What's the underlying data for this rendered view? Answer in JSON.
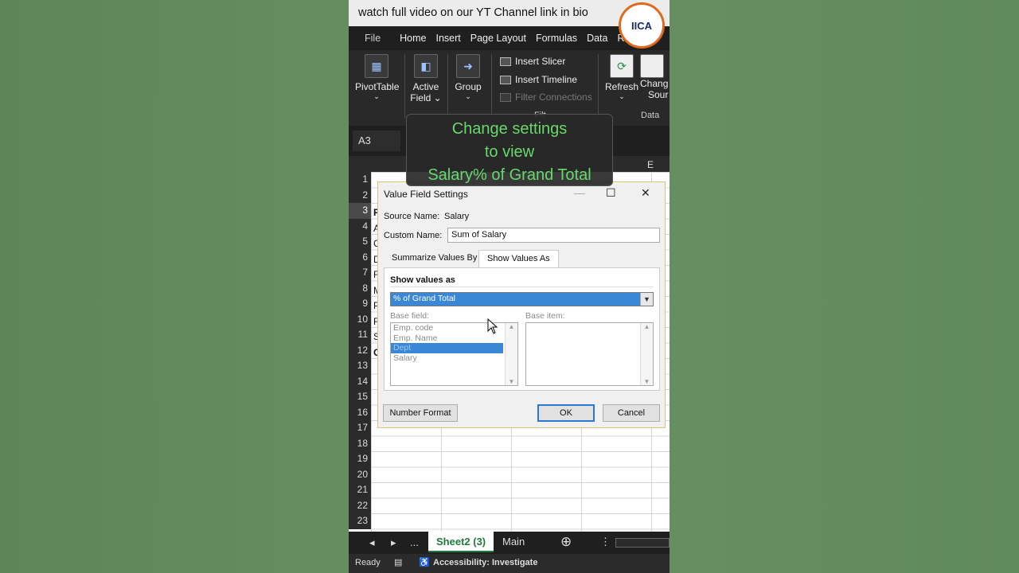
{
  "topbar": {
    "text": "watch full video on our YT Channel link in bio"
  },
  "logo": {
    "text": "IICA"
  },
  "menubar": {
    "items": [
      "File",
      "Home",
      "Insert",
      "Page Layout",
      "Formulas",
      "Data",
      "Revie"
    ]
  },
  "ribbon": {
    "pivottable": "PivotTable",
    "active_field_line1": "Active",
    "active_field_line2": "Field",
    "group": "Group",
    "insert_slicer": "Insert Slicer",
    "insert_timeline": "Insert Timeline",
    "filter_connections": "Filter Connections",
    "refresh": "Refresh",
    "change_line1": "Chang",
    "change_line2": "Sour",
    "data_group": "Data",
    "filter_group": "Filt"
  },
  "namebox": "A3",
  "colhead": {
    "e": "E"
  },
  "rows": [
    "1",
    "2",
    "3",
    "4",
    "5",
    "6",
    "7",
    "8",
    "9",
    "10",
    "11",
    "12",
    "13",
    "14",
    "15",
    "16",
    "17",
    "18",
    "19",
    "20",
    "21",
    "22",
    "23"
  ],
  "cell_fragments": [
    "R",
    "A",
    "C",
    "D",
    "F",
    "M",
    "P",
    "F",
    "S",
    "G"
  ],
  "overlay": {
    "line1": "Change settings",
    "line2": "to view",
    "line3": "Salary% of Grand Total"
  },
  "dialog": {
    "title": "Value Field Settings",
    "source_name_label": "Source Name:",
    "source_name_value": "Salary",
    "custom_name_label": "Custom Name:",
    "custom_name_value": "Sum of Salary",
    "tab_summarize": "Summarize Values By",
    "tab_show": "Show Values As",
    "show_values_as_label": "Show values as",
    "show_values_as_value": "% of Grand Total",
    "base_field_label": "Base field:",
    "base_item_label": "Base item:",
    "base_fields": [
      "Emp. code",
      "Emp. Name",
      "Dept",
      "Salary"
    ],
    "number_format": "Number Format",
    "ok": "OK",
    "cancel": "Cancel"
  },
  "sheetbar": {
    "ellipsis": "...",
    "active": "Sheet2 (3)",
    "other": "Main"
  },
  "statusbar": {
    "ready": "Ready",
    "accessibility": "Accessibility: Investigate"
  }
}
